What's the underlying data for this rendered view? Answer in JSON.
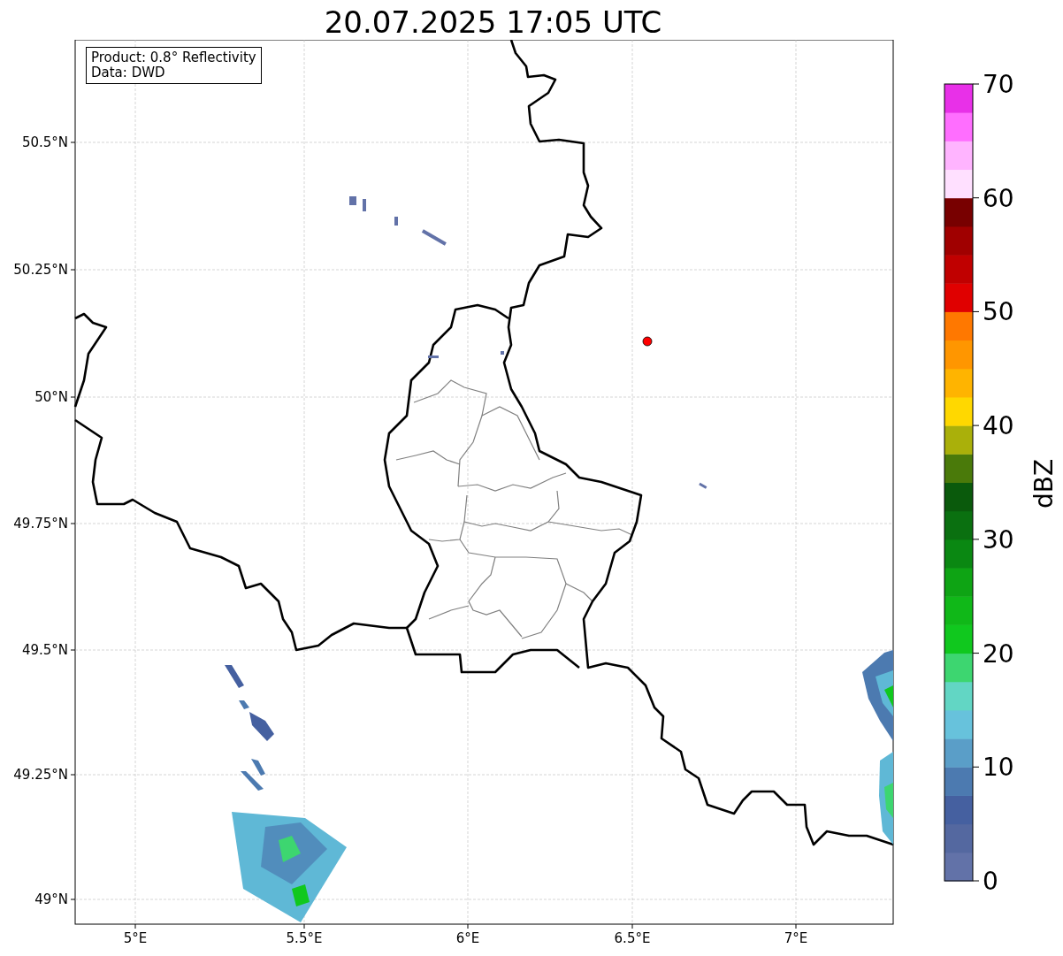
{
  "title": "20.07.2025 17:05 UTC",
  "info_box": [
    "Product: 0.8° Reflectivity",
    "Data: DWD"
  ],
  "map": {
    "xticks": [
      "5°E",
      "5.5°E",
      "6°E",
      "6.5°E",
      "7°E"
    ],
    "yticks": [
      "50.5°N",
      "50.25°N",
      "50°N",
      "49.75°N",
      "49.5°N",
      "49.25°N",
      "49°N"
    ]
  },
  "colorbar": {
    "label": "dBZ",
    "ticks": [
      "70",
      "60",
      "50",
      "40",
      "30",
      "20",
      "10",
      "0"
    ],
    "bands": [
      {
        "color": "#6272a8"
      },
      {
        "color": "#5468a0"
      },
      {
        "color": "#4560a0"
      },
      {
        "color": "#4c7ab0"
      },
      {
        "color": "#5a9ec8"
      },
      {
        "color": "#67c2dc"
      },
      {
        "color": "#62d6c4"
      },
      {
        "color": "#3dd670"
      },
      {
        "color": "#10c81e"
      },
      {
        "color": "#10b818"
      },
      {
        "color": "#0ea414"
      },
      {
        "color": "#0a8812"
      },
      {
        "color": "#0a7010"
      },
      {
        "color": "#0a5a0c"
      },
      {
        "color": "#4a7a0a"
      },
      {
        "color": "#aab00a"
      },
      {
        "color": "#ffd800"
      },
      {
        "color": "#ffb400"
      },
      {
        "color": "#ff9600"
      },
      {
        "color": "#ff7800"
      },
      {
        "color": "#e00000"
      },
      {
        "color": "#c00000"
      },
      {
        "color": "#a00000"
      },
      {
        "color": "#780000"
      },
      {
        "color": "#ffe0ff"
      },
      {
        "color": "#ffb4ff"
      },
      {
        "color": "#ff6eff"
      },
      {
        "color": "#e830e8"
      }
    ]
  }
}
